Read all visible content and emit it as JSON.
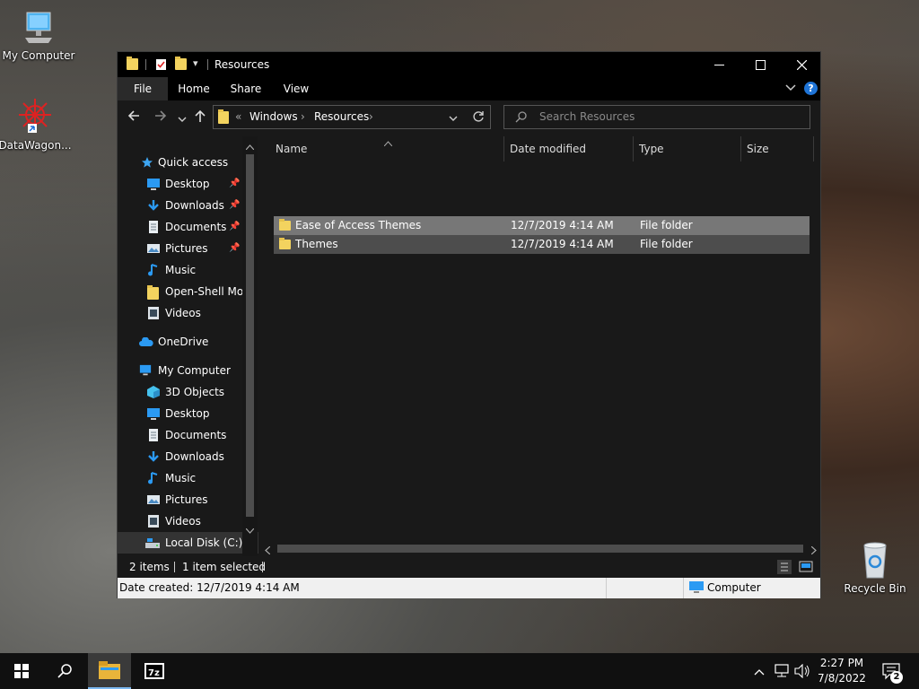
{
  "desktop": {
    "icons": [
      {
        "label": "My Computer",
        "icon": "computer-icon"
      },
      {
        "label": "DataWagon...",
        "icon": "datawagon-shortcut-icon"
      },
      {
        "label": "Recycle Bin",
        "icon": "recycle-bin-icon"
      }
    ]
  },
  "window": {
    "title": "Resources",
    "ribbon_tabs": [
      "File",
      "Home",
      "Share",
      "View"
    ],
    "address": {
      "overflow": "«",
      "crumbs": [
        "Windows",
        "Resources"
      ]
    },
    "search_placeholder": "Search Resources",
    "nav": {
      "quick_access": "Quick access",
      "quick_items": [
        {
          "label": "Desktop",
          "pinned": true
        },
        {
          "label": "Downloads",
          "pinned": true
        },
        {
          "label": "Documents",
          "pinned": true
        },
        {
          "label": "Pictures",
          "pinned": true
        },
        {
          "label": "Music",
          "pinned": false
        },
        {
          "label": "Open-Shell Mod",
          "pinned": false
        },
        {
          "label": "Videos",
          "pinned": false
        }
      ],
      "onedrive": "OneDrive",
      "this_pc": "My Computer",
      "pc_items": [
        "3D Objects",
        "Desktop",
        "Documents",
        "Downloads",
        "Music",
        "Pictures",
        "Videos",
        "Local Disk (C:)"
      ]
    },
    "columns": [
      "Name",
      "Date modified",
      "Type",
      "Size"
    ],
    "files": [
      {
        "name": "Ease of Access Themes",
        "date": "12/7/2019 4:14 AM",
        "type": "File folder",
        "size": "",
        "selected": true
      },
      {
        "name": "Themes",
        "date": "12/7/2019 4:14 AM",
        "type": "File folder",
        "size": "",
        "selected": false
      }
    ],
    "status": {
      "count": "2 items",
      "selection": "1 item selected"
    },
    "details": {
      "created": "Date created: 12/7/2019 4:14 AM",
      "location": "Computer"
    }
  },
  "taskbar": {
    "time": "2:27 PM",
    "date": "7/8/2022",
    "notification_count": "2",
    "pinned": [
      "start-icon",
      "search-icon",
      "file-explorer-icon",
      "7zip-icon"
    ]
  }
}
